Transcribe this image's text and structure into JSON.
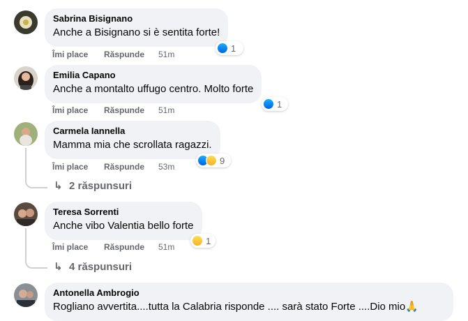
{
  "colors": {
    "bubble": "#f0f2f5",
    "meta": "#65676b",
    "like_blue": "#1877f2"
  },
  "comments": [
    {
      "author": "Sabrina Bisignano",
      "text": "Anche a Bisignano si è sentita forte!",
      "like_label": "Îmi place",
      "reply_label": "Răspunde",
      "time": "51m",
      "reaction_icons": [
        "like-icon"
      ],
      "reaction_count": "1"
    },
    {
      "author": "Emilia Capano",
      "text": "Anche a montalto uffugo centro. Molto forte",
      "like_label": "Îmi place",
      "reply_label": "Răspunde",
      "time": "51m",
      "reaction_icons": [
        "like-icon"
      ],
      "reaction_count": "1"
    },
    {
      "author": "Carmela Iannella",
      "text": "Mamma mia che scrollata ragazzi.",
      "like_label": "Îmi place",
      "reply_label": "Răspunde",
      "time": "53m",
      "reaction_icons": [
        "like-icon",
        "sad-icon"
      ],
      "reaction_count": "9",
      "replies_label": "2 răspunsuri"
    },
    {
      "author": "Teresa Sorrenti",
      "text": "Anche vibo Valentia bello forte",
      "like_label": "Îmi place",
      "reply_label": "Răspunde",
      "time": "51m",
      "reaction_icons": [
        "care-icon"
      ],
      "reaction_count": "1",
      "replies_label": "4 răspunsuri"
    },
    {
      "author": "Antonella Ambrogio",
      "text": "Rogliano avvertita....tutta la Calabria risponde .... sarà stato Forte ....Dio mio🙏"
    }
  ]
}
